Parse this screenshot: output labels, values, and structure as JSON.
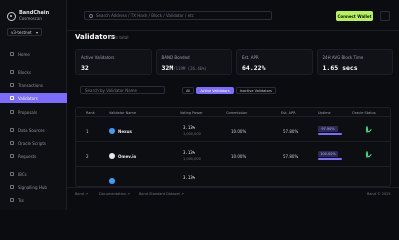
{
  "app": {
    "brand_line1": "BandChain",
    "brand_line2": "Cosmoscan"
  },
  "network": {
    "selected": "v3-testnet"
  },
  "sidebar": {
    "items": [
      {
        "label": "Home",
        "icon": "home-icon"
      },
      {
        "label": "Blocks",
        "icon": "blocks-icon"
      },
      {
        "label": "Transactions",
        "icon": "transactions-icon"
      },
      {
        "label": "Validators",
        "icon": "validators-icon",
        "active": true
      },
      {
        "label": "Proposals",
        "icon": "proposals-icon"
      },
      {
        "label": "Data Sources",
        "icon": "data-sources-icon"
      },
      {
        "label": "Oracle Scripts",
        "icon": "oracle-scripts-icon"
      },
      {
        "label": "Requests",
        "icon": "requests-icon"
      },
      {
        "label": "IBCs",
        "icon": "ibc-icon"
      },
      {
        "label": "Signalling Hub",
        "icon": "signalling-icon"
      },
      {
        "label": "Tss",
        "icon": "tss-icon"
      }
    ]
  },
  "topbar": {
    "search_placeholder": "Search Address / TX Hash / Block / Validator / etc",
    "connect_label": "Connect Wallet"
  },
  "page": {
    "title": "Validators",
    "meta": "84 In total"
  },
  "stats": [
    {
      "label": "Active Validators",
      "value": "32",
      "sub": ""
    },
    {
      "label": "BAND Bonded",
      "value": "32M",
      "sub": "/119M (26.46%)"
    },
    {
      "label": "Est. APR",
      "value": "64.22%",
      "sub": ""
    },
    {
      "label": "24H AVG Block Time",
      "value": "1.65 secs",
      "sub": ""
    }
  ],
  "filters": {
    "search_placeholder": "Search by Validator Name",
    "pills": [
      {
        "label": "All",
        "active": false
      },
      {
        "label": "Active Validators",
        "active": true
      },
      {
        "label": "Inactive Validators",
        "active": false
      }
    ]
  },
  "table": {
    "headers": [
      "Rank",
      "Validator Name",
      "Voting Power",
      "Commission",
      "Est. APR",
      "Uptime",
      "Oracle Status"
    ],
    "rows": [
      {
        "rank": "1",
        "name": "Nexus",
        "avatar_color": "#3aa0ff",
        "vp_pct": "3.13%",
        "vp_amount": "1,000,000",
        "commission": "10.00%",
        "apr": "57.80%",
        "uptime": "97.90%",
        "uptime_frac": 0.98
      },
      {
        "rank": "2",
        "name": "Omev.io",
        "avatar_color": "#e6e7ea",
        "vp_pct": "3.13%",
        "vp_amount": "1,000,000",
        "commission": "10.00%",
        "apr": "57.80%",
        "uptime": "100.00%",
        "uptime_frac": 1.0
      },
      {
        "rank": "3",
        "name": "",
        "avatar_color": "#3aa0ff",
        "vp_pct": "3.13%",
        "vp_amount": "",
        "commission": "",
        "apr": "",
        "uptime": "",
        "uptime_frac": 0
      }
    ]
  },
  "footer": {
    "links": [
      "Band ↗",
      "Documentation ↗",
      "Band Standard Dataset ↗"
    ],
    "copyright": "Band © 2025"
  },
  "colors": {
    "accent": "#7c6cff",
    "connect": "#b8f25a",
    "status_ok": "#3ddc84"
  }
}
